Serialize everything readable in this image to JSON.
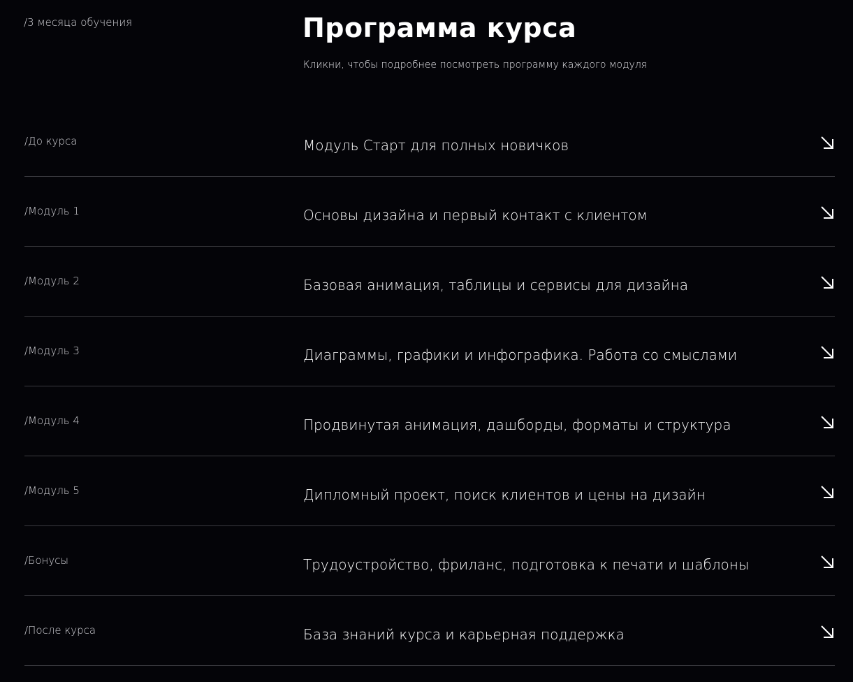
{
  "header": {
    "duration": "/3 месяца обучения",
    "title": "Программа курса",
    "subtitle": "Кликни, чтобы подробнее посмотреть программу каждого модуля"
  },
  "modules": [
    {
      "tag": "/До курса",
      "name": "Модуль Старт для полных новичков",
      "icon": "arrow-down-right-icon"
    },
    {
      "tag": "/Модуль 1",
      "name": "Основы дизайна и первый контакт с клиентом",
      "icon": "arrow-down-right-icon"
    },
    {
      "tag": "/Модуль 2",
      "name": "Базовая анимация, таблицы и сервисы для дизайна",
      "icon": "arrow-down-right-icon"
    },
    {
      "tag": "/Модуль 3",
      "name": "Диаграммы, графики и инфографика. Работа со смыслами",
      "icon": "arrow-down-right-icon"
    },
    {
      "tag": "/Модуль 4",
      "name": "Продвинутая анимация, дашборды, форматы и структура",
      "icon": "arrow-down-right-icon"
    },
    {
      "tag": "/Модуль 5",
      "name": "Дипломный проект, поиск клиентов и цены на дизайн",
      "icon": "arrow-down-right-icon"
    },
    {
      "tag": "/Бонусы",
      "name": "Трудоустройство, фриланс, подготовка к печати и шаблоны",
      "icon": "arrow-down-right-icon"
    },
    {
      "tag": "/После курса",
      "name": "База знаний курса и карьерная поддержка",
      "icon": "arrow-down-right-icon"
    }
  ],
  "colors": {
    "background": "#040408",
    "text": "#ffffff",
    "muted_text": "#cfcfd4",
    "divider": "#3b3b40"
  }
}
